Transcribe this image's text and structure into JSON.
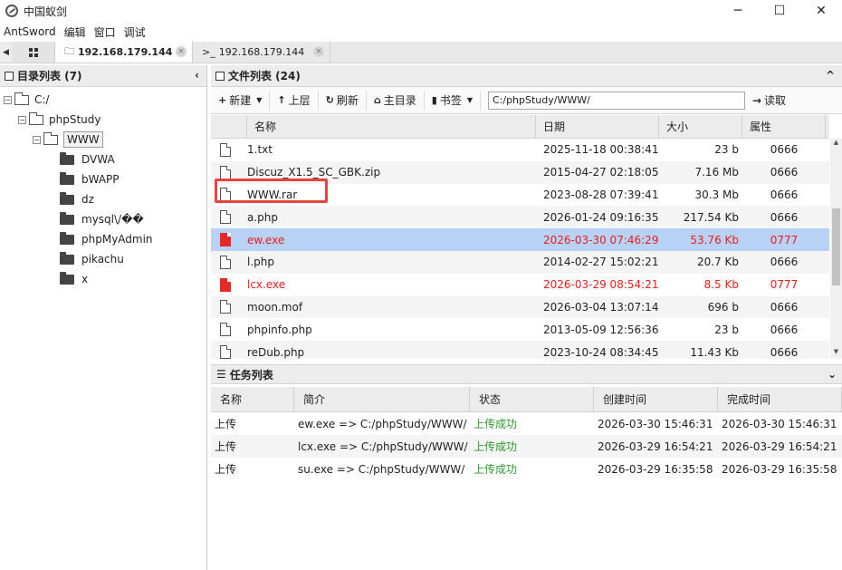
{
  "window": {
    "title": "中国蚁剑",
    "controls": [
      "─",
      "☐",
      "✕"
    ]
  },
  "menu": [
    "AntSword",
    "编辑",
    "窗口",
    "调试"
  ],
  "tabs": [
    {
      "icon": "🗀",
      "label": "192.168.179.144",
      "close": "×"
    },
    {
      "icon": ">_",
      "label": "192.168.179.144",
      "close": "×"
    }
  ],
  "left": {
    "title": "目录列表 (7)",
    "collapse": "‹",
    "tree": [
      {
        "label": "C:/",
        "expander": "−"
      },
      {
        "label": "phpStudy",
        "expander": "−"
      },
      {
        "label": "WWW",
        "expander": "−"
      },
      {
        "label": "DVWA"
      },
      {
        "label": "bWAPP"
      },
      {
        "label": "dz"
      },
      {
        "label": "mysql\\/��"
      },
      {
        "label": "phpMyAdmin"
      },
      {
        "label": "pikachu"
      },
      {
        "label": "x"
      }
    ]
  },
  "right": {
    "title": "文件列表 (24)",
    "collapse": "^",
    "toolbar": {
      "new": "新建",
      "up": "上层",
      "refresh": "刷新",
      "home": "主目录",
      "bookmark": "书签",
      "path": "C:/phpStudy/WWW/",
      "read": "读取"
    },
    "columns": [
      "名称",
      "日期",
      "大小",
      "属性"
    ],
    "files": [
      {
        "name": "1.txt",
        "date": "2025-11-18 00:38:41",
        "size": "23 b",
        "attr": "0666",
        "icon": "txt"
      },
      {
        "name": "Discuz_X1.5_SC_GBK.zip",
        "date": "2015-04-27 02:18:05",
        "size": "7.16 Mb",
        "attr": "0666",
        "icon": "zip"
      },
      {
        "name": "WWW.rar",
        "date": "2023-08-28 07:39:41",
        "size": "30.3 Mb",
        "attr": "0666",
        "icon": "zip"
      },
      {
        "name": "a.php",
        "date": "2026-01-24 09:16:35",
        "size": "217.54 Kb",
        "attr": "0666",
        "icon": "php"
      },
      {
        "name": "ew.exe",
        "date": "2026-03-30 07:46:29",
        "size": "53.76 Kb",
        "attr": "0777",
        "icon": "exe"
      },
      {
        "name": "l.php",
        "date": "2014-02-27 15:02:21",
        "size": "20.7 Kb",
        "attr": "0666",
        "icon": "php"
      },
      {
        "name": "lcx.exe",
        "date": "2026-03-29 08:54:21",
        "size": "8.5 Kb",
        "attr": "0777",
        "icon": "exe"
      },
      {
        "name": "moon.mof",
        "date": "2026-03-04 13:07:14",
        "size": "696 b",
        "attr": "0666",
        "icon": "file"
      },
      {
        "name": "phpinfo.php",
        "date": "2013-05-09 12:56:36",
        "size": "23 b",
        "attr": "0666",
        "icon": "php"
      },
      {
        "name": "reDub.php",
        "date": "2023-10-24 08:34:45",
        "size": "11.43 Kb",
        "attr": "0666",
        "icon": "php"
      }
    ]
  },
  "tasks": {
    "title": "任务列表",
    "collapse": "⌄",
    "columns": [
      "名称",
      "简介",
      "状态",
      "创建时间",
      "完成时间"
    ],
    "rows": [
      {
        "name": "上传",
        "desc": "ew.exe => C:/phpStudy/WWW/",
        "status": "上传成功",
        "created": "2026-03-30 15:46:31",
        "done": "2026-03-30 15:46:31"
      },
      {
        "name": "上传",
        "desc": "lcx.exe => C:/phpStudy/WWW/",
        "status": "上传成功",
        "created": "2026-03-29 16:54:21",
        "done": "2026-03-29 16:54:21"
      },
      {
        "name": "上传",
        "desc": "su.exe => C:/phpStudy/WWW/",
        "status": "上传成功",
        "created": "2026-03-29 16:35:58",
        "done": "2026-03-29 16:35:58"
      }
    ]
  },
  "colors": {
    "exe_red": "#ea1c1c",
    "selected_row": "#b7d2f5",
    "success_green": "#2d9a2d",
    "highlight_box": "#e8443e"
  }
}
